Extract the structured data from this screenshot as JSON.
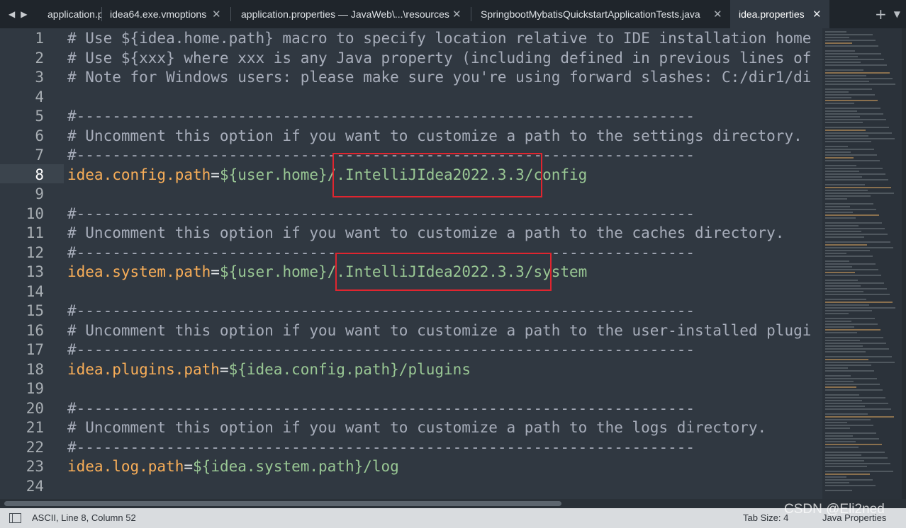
{
  "tabs": [
    {
      "label": "application.p",
      "active": false
    },
    {
      "label": "idea64.exe.vmoptions",
      "active": false
    },
    {
      "label": "application.properties — JavaWeb\\...\\resources",
      "active": false
    },
    {
      "label": "SpringbootMybatisQuickstartApplicationTests.java",
      "active": false
    },
    {
      "label": "idea.properties",
      "active": true
    }
  ],
  "tab_close_glyph": "✕",
  "nav": {
    "back_glyph": "◀",
    "forward_glyph": "▶"
  },
  "toolbar": {
    "new_tab_glyph": "+",
    "menu_glyph": "▼"
  },
  "editor": {
    "active_line": 8,
    "lines": [
      {
        "n": "1",
        "parts": [
          {
            "t": "# Use ${idea.home.path} macro to specify location relative to IDE installation home",
            "c": "comment"
          }
        ]
      },
      {
        "n": "2",
        "parts": [
          {
            "t": "# Use ${xxx} where xxx is any Java property (including defined in previous lines of",
            "c": "comment"
          }
        ]
      },
      {
        "n": "3",
        "parts": [
          {
            "t": "# Note for Windows users: please make sure you're using forward slashes: C:/dir1/di",
            "c": "comment"
          }
        ]
      },
      {
        "n": "4",
        "parts": []
      },
      {
        "n": "5",
        "parts": [
          {
            "t": "#---------------------------------------------------------------------",
            "c": "comment"
          }
        ]
      },
      {
        "n": "6",
        "parts": [
          {
            "t": "# Uncomment this option if you want to customize a path to the settings directory.",
            "c": "comment"
          }
        ]
      },
      {
        "n": "7",
        "parts": [
          {
            "t": "#---------------------------------------------------------------------",
            "c": "comment"
          }
        ]
      },
      {
        "n": "8",
        "parts": [
          {
            "t": "idea.config.path",
            "c": "key"
          },
          {
            "t": "=",
            "c": "eq"
          },
          {
            "t": "${user.home}/.IntelliJIdea2022.3.3/config",
            "c": "val"
          }
        ]
      },
      {
        "n": "9",
        "parts": []
      },
      {
        "n": "10",
        "parts": [
          {
            "t": "#---------------------------------------------------------------------",
            "c": "comment"
          }
        ]
      },
      {
        "n": "11",
        "parts": [
          {
            "t": "# Uncomment this option if you want to customize a path to the caches directory.",
            "c": "comment"
          }
        ]
      },
      {
        "n": "12",
        "parts": [
          {
            "t": "#---------------------------------------------------------------------",
            "c": "comment"
          }
        ]
      },
      {
        "n": "13",
        "parts": [
          {
            "t": "idea.system.path",
            "c": "key"
          },
          {
            "t": "=",
            "c": "eq"
          },
          {
            "t": "${user.home}/.IntelliJIdea2022.3.3/system",
            "c": "val"
          }
        ]
      },
      {
        "n": "14",
        "parts": []
      },
      {
        "n": "15",
        "parts": [
          {
            "t": "#---------------------------------------------------------------------",
            "c": "comment"
          }
        ]
      },
      {
        "n": "16",
        "parts": [
          {
            "t": "# Uncomment this option if you want to customize a path to the user-installed plugi",
            "c": "comment"
          }
        ]
      },
      {
        "n": "17",
        "parts": [
          {
            "t": "#---------------------------------------------------------------------",
            "c": "comment"
          }
        ]
      },
      {
        "n": "18",
        "parts": [
          {
            "t": "idea.plugins.path",
            "c": "key"
          },
          {
            "t": "=",
            "c": "eq"
          },
          {
            "t": "${idea.config.path}/plugins",
            "c": "val"
          }
        ]
      },
      {
        "n": "19",
        "parts": []
      },
      {
        "n": "20",
        "parts": [
          {
            "t": "#---------------------------------------------------------------------",
            "c": "comment"
          }
        ]
      },
      {
        "n": "21",
        "parts": [
          {
            "t": "# Uncomment this option if you want to customize a path to the logs directory.",
            "c": "comment"
          }
        ]
      },
      {
        "n": "22",
        "parts": [
          {
            "t": "#---------------------------------------------------------------------",
            "c": "comment"
          }
        ]
      },
      {
        "n": "23",
        "parts": [
          {
            "t": "idea.log.path",
            "c": "key"
          },
          {
            "t": "=",
            "c": "eq"
          },
          {
            "t": "${idea.system.path}/log",
            "c": "val"
          }
        ]
      },
      {
        "n": "24",
        "parts": []
      }
    ]
  },
  "status": {
    "left": "ASCII, Line 8, Column 52",
    "tab_size": "Tab Size: 4",
    "syntax": "Java Properties"
  },
  "watermark": "CSDN @Eli2ned",
  "colors": {
    "background": "#303841",
    "comment": "#a7adba",
    "key": "#f9ae58",
    "value": "#99c794",
    "annotation": "#e0252f"
  }
}
